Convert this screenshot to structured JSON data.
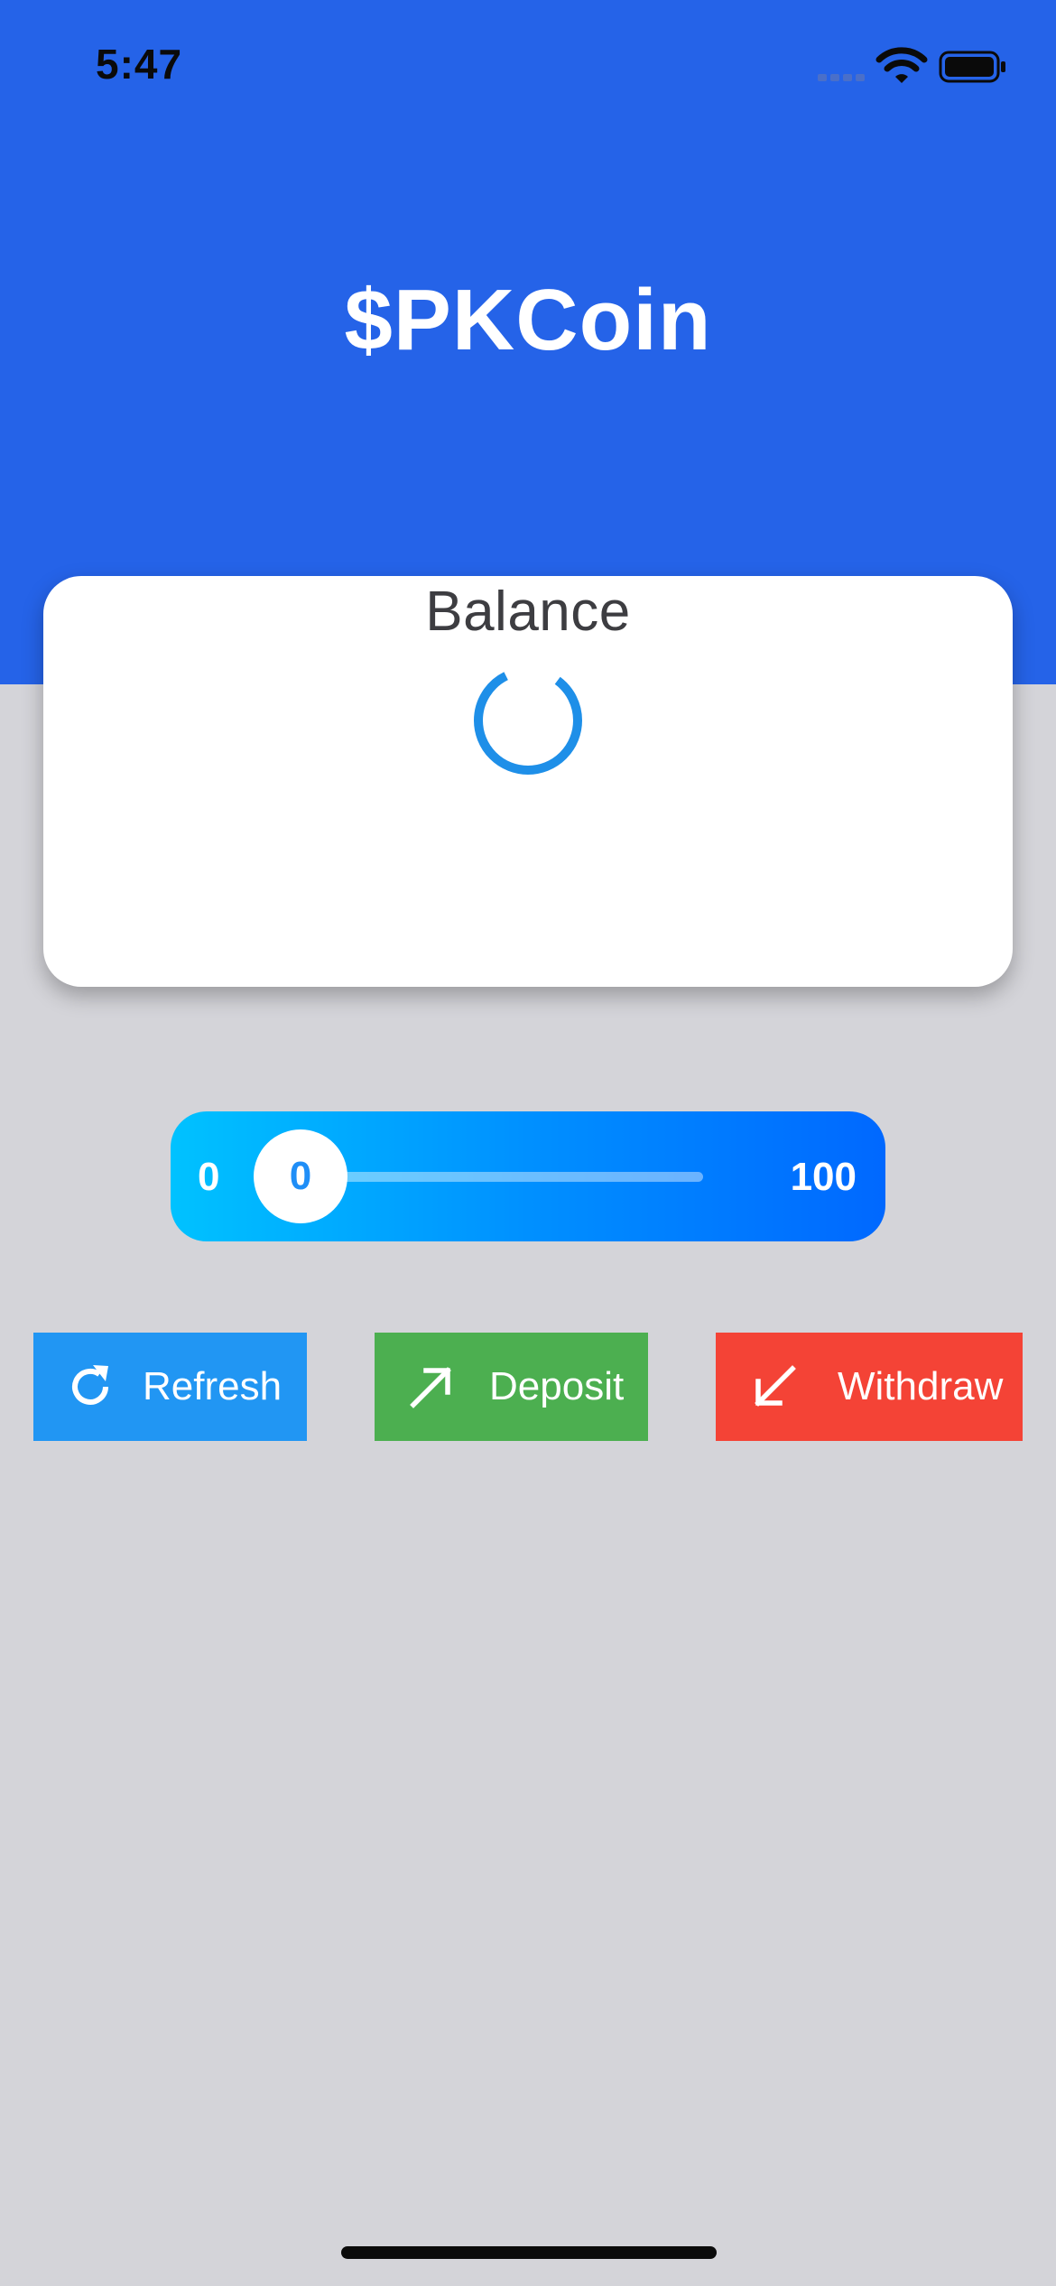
{
  "status_bar": {
    "time": "5:47",
    "icons": [
      "cellular-signal-icon",
      "wifi-icon",
      "battery-icon"
    ]
  },
  "header": {
    "title": "$PKCoin",
    "background_color": "#2563e8"
  },
  "balance_card": {
    "label": "Balance",
    "loading": true,
    "spinner_icon": "loading-spinner-icon",
    "spinner_color": "#1e8fe8"
  },
  "amount_slider": {
    "min_label": "0",
    "max_label": "100",
    "value": "0",
    "gradient_colors": [
      "#00c2ff",
      "#0068ff"
    ]
  },
  "actions": {
    "refresh": {
      "label": "Refresh",
      "icon": "refresh-icon",
      "color": "#2196f3"
    },
    "deposit": {
      "label": "Deposit",
      "icon": "arrow-up-right-icon",
      "color": "#4caf50"
    },
    "withdraw": {
      "label": "Withdraw",
      "icon": "arrow-down-left-icon",
      "color": "#f44336"
    }
  },
  "page": {
    "background_color": "#d4d4d9"
  }
}
